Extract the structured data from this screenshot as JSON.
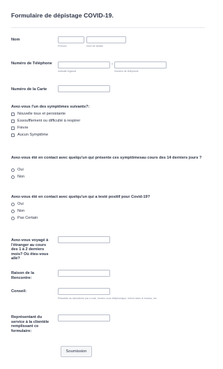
{
  "form": {
    "title": "Formulaire de dépistage COVID-19.",
    "name": {
      "label": "Nom",
      "first_sub": "Prénom",
      "last_sub": "Nom de famille",
      "first_value": "",
      "last_value": ""
    },
    "phone": {
      "label": "Numéro de Téléphone",
      "area_sub": "Indicatif régional",
      "number_sub": "Numéro de téléphone",
      "separator": "-",
      "area_value": "",
      "number_value": ""
    },
    "card": {
      "label": "Numéro de la Carte",
      "value": ""
    },
    "symptoms": {
      "question": "Avez-vous l'un des symptômes suivants?:",
      "options": [
        "Nouvelle toux et persistante",
        "Essoufflement ou difficulté à respirer",
        "Fièvre",
        "Aucun Symptôme"
      ]
    },
    "contact": {
      "question": "Avez-vous été en contact avec quelqu'un qui présente ces symptômesau cours des 14 derniers jours ?",
      "options": [
        "Oui",
        "Non"
      ]
    },
    "positive": {
      "question": "Avez-vous été en contact avec quelqu'un qui a testé positif pour Covid-19?",
      "options": [
        "Oui",
        "Non",
        "Pas Certain"
      ]
    },
    "travel": {
      "label": "Avez-vous voyagé à l'étranger au cours des 1 à 2 derniers mois? Où êtes-vous allé?",
      "value": ""
    },
    "reason": {
      "label": "Raison de la Rencontre:",
      "value": ""
    },
    "advice": {
      "label": "Conseil:",
      "sub": "Résultats du laboratoire par e-mail, rendez-vous téléphonique, entrez dans le bureau, etc",
      "value": ""
    },
    "rep": {
      "label": "Représentant du service à la clientèle remplissant ce formulaire:",
      "value": ""
    },
    "submit_label": "Soumission"
  }
}
